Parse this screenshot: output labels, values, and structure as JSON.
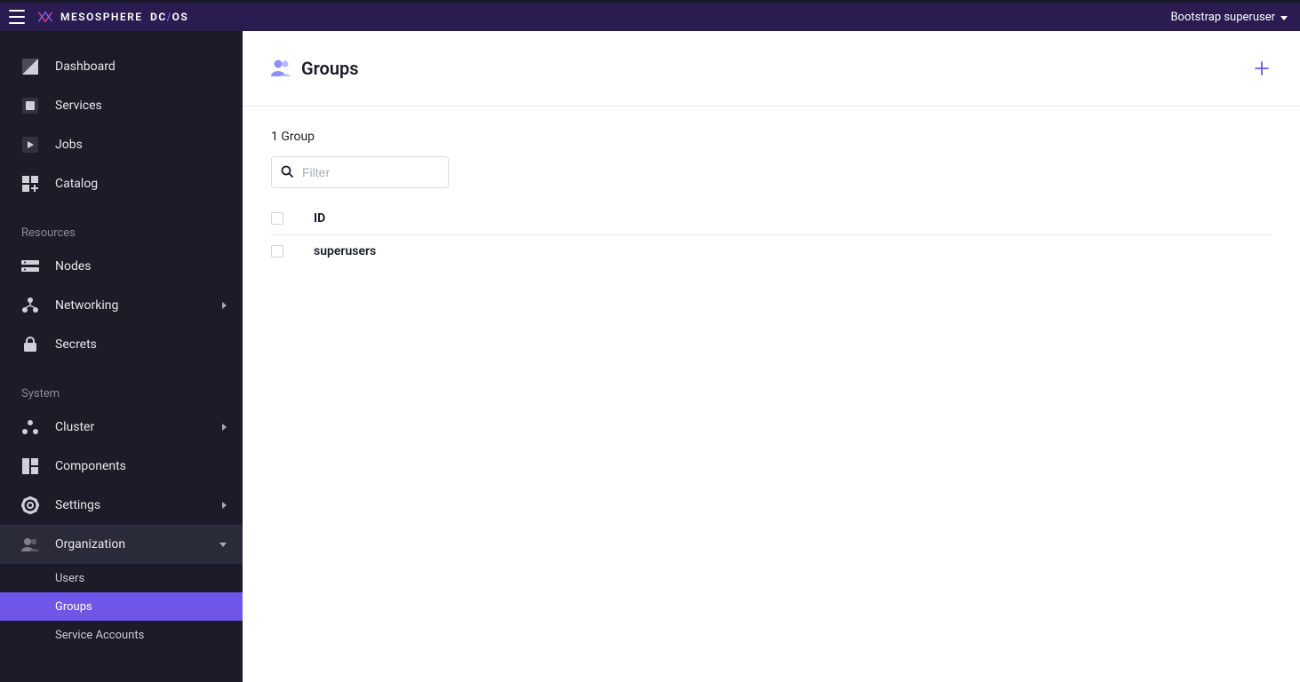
{
  "colors": {
    "topbar": "#2a1b51",
    "sidebar": "#1b1c28",
    "accent": "#6f56e8",
    "brandAccent": "#e83e8c"
  },
  "topbar": {
    "brand_meso": "MESOSPHERE",
    "brand_dc": "DC",
    "brand_slash": "/",
    "brand_os": "OS",
    "user_label": "Bootstrap superuser"
  },
  "sidebar": {
    "primary": [
      {
        "label": "Dashboard",
        "icon": "dashboard"
      },
      {
        "label": "Services",
        "icon": "services"
      },
      {
        "label": "Jobs",
        "icon": "jobs"
      },
      {
        "label": "Catalog",
        "icon": "catalog"
      }
    ],
    "sections": [
      {
        "title": "Resources",
        "items": [
          {
            "label": "Nodes",
            "icon": "nodes",
            "caret": null
          },
          {
            "label": "Networking",
            "icon": "networking",
            "caret": "right"
          },
          {
            "label": "Secrets",
            "icon": "secrets",
            "caret": null
          }
        ]
      },
      {
        "title": "System",
        "items": [
          {
            "label": "Cluster",
            "icon": "cluster",
            "caret": "right"
          },
          {
            "label": "Components",
            "icon": "components",
            "caret": null
          },
          {
            "label": "Settings",
            "icon": "settings",
            "caret": "right"
          },
          {
            "label": "Organization",
            "icon": "organization",
            "caret": "down",
            "expanded": true,
            "children": [
              {
                "label": "Users",
                "active": false
              },
              {
                "label": "Groups",
                "active": true
              },
              {
                "label": "Service Accounts",
                "active": false
              }
            ]
          }
        ]
      }
    ]
  },
  "page": {
    "title": "Groups",
    "count_label": "1 Group",
    "filter_placeholder": "Filter",
    "table": {
      "header_id": "ID",
      "rows": [
        {
          "id": "superusers"
        }
      ]
    }
  }
}
